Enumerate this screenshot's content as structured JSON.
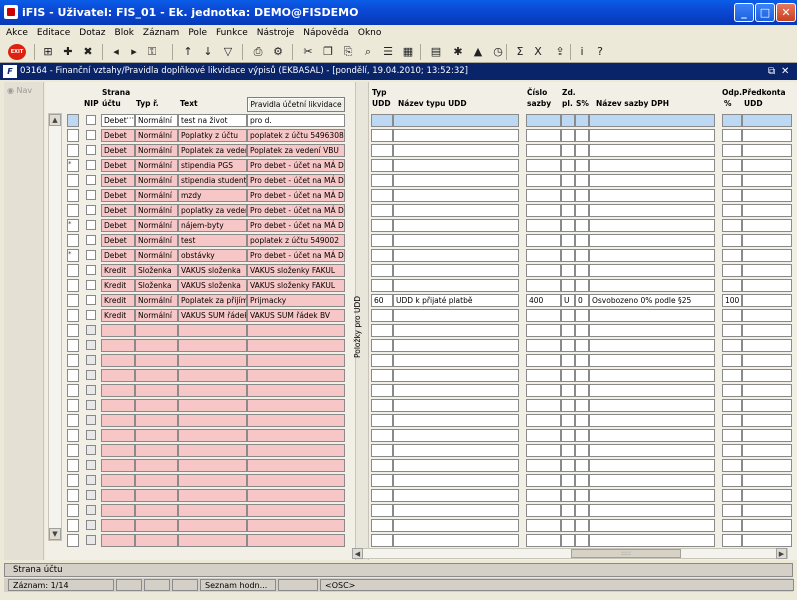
{
  "window": {
    "title": "iFIS - Uživatel: FIS_01 - Ek. jednotka: DEMO@FISDEMO"
  },
  "menu": [
    "Akce",
    "Editace",
    "Dotaz",
    "Blok",
    "Záznam",
    "Pole",
    "Funkce",
    "Nástroje",
    "Nápověda",
    "Okno"
  ],
  "toolbar": {
    "exit_label": "EXIT",
    "icons": [
      "save-icon",
      "insert-record-icon",
      "delete-record-icon",
      "prev-record-icon",
      "next-record-icon",
      "lock-icon",
      "sort-asc-icon",
      "sort-desc-icon",
      "filter-icon",
      "print-icon",
      "print-setup-icon",
      "cut-icon",
      "copy-icon",
      "paste-icon",
      "find-icon",
      "list-icon",
      "grid-icon",
      "calculator-icon",
      "tools-icon",
      "chart-icon",
      "clock-icon",
      "sum-icon",
      "excel-icon",
      "export-icon",
      "info-icon",
      "help-icon"
    ]
  },
  "mdi": {
    "title": "03164 - Finanční vztahy/Pravidla doplňkové likvidace výpisů (EKBASAL) - [pondělí, 19.04.2010; 13:52:32]"
  },
  "nav": {
    "label": "Nav"
  },
  "left_table": {
    "headers": {
      "nip": "NIP",
      "strana_top": "Strana",
      "strana_bottom": "účtu",
      "typ": "Typ ř.",
      "text": "Text",
      "button": "Pravidla účetní likvidace"
    },
    "rows": [
      {
        "strana": "Debet",
        "typ": "Normální",
        "text": "test na život",
        "pravidla": "pro d.",
        "marker": ""
      },
      {
        "strana": "Debet",
        "typ": "Normální",
        "text": "Poplatky z účtu",
        "pravidla": "poplatek z účtu 54963080",
        "marker": ""
      },
      {
        "strana": "Debet",
        "typ": "Normální",
        "text": "Poplatek za veder",
        "pravidla": "Poplatek za vedení VBU",
        "marker": ""
      },
      {
        "strana": "Debet",
        "typ": "Normální",
        "text": "stipendia PGS",
        "pravidla": "Pro debet - účet na MÁ D",
        "marker": "*"
      },
      {
        "strana": "Debet",
        "typ": "Normální",
        "text": "stipendia student",
        "pravidla": "Pro debet - účet na MÁ D",
        "marker": ""
      },
      {
        "strana": "Debet",
        "typ": "Normální",
        "text": "mzdy",
        "pravidla": "Pro debet - účet na MÁ D",
        "marker": ""
      },
      {
        "strana": "Debet",
        "typ": "Normální",
        "text": "poplatky za veder",
        "pravidla": "Pro debet - účet na MÁ D",
        "marker": ""
      },
      {
        "strana": "Debet",
        "typ": "Normální",
        "text": "nájem-byty",
        "pravidla": "Pro debet - účet na MÁ D",
        "marker": "*"
      },
      {
        "strana": "Debet",
        "typ": "Normální",
        "text": "test",
        "pravidla": "poplatek z účtu 549002",
        "marker": ""
      },
      {
        "strana": "Debet",
        "typ": "Normální",
        "text": "obstávky",
        "pravidla": "Pro debet - účet na MÁ D",
        "marker": "*"
      },
      {
        "strana": "Kredit",
        "typ": "Složenka",
        "text": "VAKUS složenka",
        "pravidla": "VAKUS složenky FAKUL",
        "marker": ""
      },
      {
        "strana": "Kredit",
        "typ": "Složenka",
        "text": "VAKUS složenka",
        "pravidla": "VAKUS složenky FAKUL",
        "marker": ""
      },
      {
        "strana": "Kredit",
        "typ": "Normální",
        "text": "Poplatek za přijímá",
        "pravidla": "Prijmacky",
        "marker": ""
      },
      {
        "strana": "Kredit",
        "typ": "Normální",
        "text": "VAKUS SUM řádek",
        "pravidla": "VAKUS SUM řádek BV",
        "marker": ""
      }
    ]
  },
  "separator": {
    "label": "Položky pro UDD"
  },
  "right_table": {
    "headers": {
      "typ_top": "Typ",
      "typ_bottom": "UDD",
      "nazev_udd": "Název typu UDD",
      "cislo_top": "Číslo",
      "cislo_bottom": "sazby",
      "zd_top": "Zd.",
      "zd_bottom": "pl.",
      "s": "S%",
      "nazev_sazby": "Název sazby DPH",
      "odp_top": "Odp.",
      "odp_bottom": "%",
      "pred_top": "Předkonta",
      "pred_bottom": "UDD"
    },
    "row13": {
      "typ": "60",
      "nazev": "UDD k přijaté platbě",
      "cislo": "400",
      "zd": "U",
      "s": "0",
      "sazba": "Osvobozeno 0% podle §25",
      "odp": "100"
    }
  },
  "status": {
    "line1": "Strana účtu",
    "zaznam": "Záznam: 1/14",
    "list": "Seznam hodn...",
    "osc": "<OSC>"
  }
}
